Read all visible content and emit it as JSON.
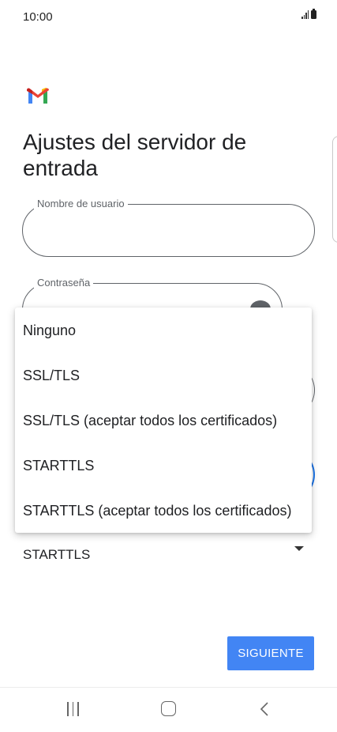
{
  "status_bar": {
    "time": "10:00",
    "icons": [
      "signal-icon",
      "battery-icon"
    ]
  },
  "app": {
    "logo": "gmail-logo",
    "title": "Ajustes del servidor de entrada"
  },
  "form": {
    "username": {
      "label": "Nombre de usuario",
      "value": ""
    },
    "password": {
      "label": "Contraseña",
      "value": "",
      "icon": "visibility-icon"
    },
    "security_type": {
      "selected": "STARTTLS",
      "options": [
        "Ninguno",
        "SSL/TLS",
        "SSL/TLS (aceptar todos los certificados)",
        "STARTTLS",
        "STARTTLS (aceptar todos los certificados)"
      ]
    }
  },
  "actions": {
    "next_label": "SIGUIENTE",
    "next_color": "#4285f4"
  },
  "nav_bar": {
    "icons": [
      "recents-icon",
      "home-icon",
      "back-icon"
    ]
  }
}
